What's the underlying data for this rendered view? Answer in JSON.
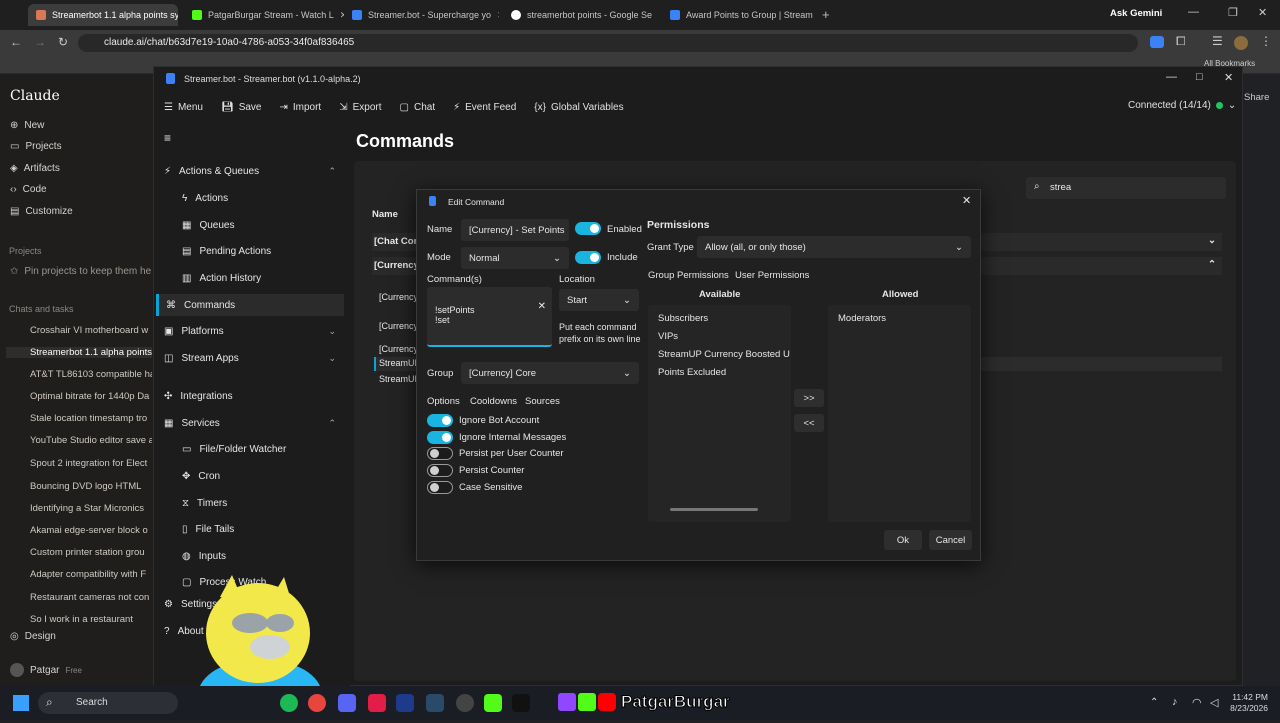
{
  "browser": {
    "tabs": [
      {
        "title": "Streamerbot 1.1 alpha points sy",
        "color": "#d97757"
      },
      {
        "title": "PatgarBurgar Stream - Watch L",
        "color": "#53fc18"
      },
      {
        "title": "Streamer.bot - Supercharge yo",
        "color": "#3b82f6"
      },
      {
        "title": "streamerbot points - Google Se",
        "color": "#ffffff"
      },
      {
        "title": "Award Points to Group | Stream",
        "color": "#3b82f6"
      }
    ],
    "ask_gemini": "Ask Gemini",
    "url": "claude.ai/chat/b63d7e19-10a0-4786-a053-34f0af836465",
    "all_bookmarks": "All Bookmarks"
  },
  "claude": {
    "brand": "Claude",
    "new": "New",
    "projects": "Projects",
    "artifacts": "Artifacts",
    "code": "Code",
    "customize": "Customize",
    "projects_head": "Projects",
    "pin": "Pin projects to keep them he",
    "chats_head": "Chats and tasks",
    "chats": [
      "Crosshair VI motherboard w",
      "Streamerbot 1.1 alpha points",
      "AT&T TL86103 compatible ha",
      "Optimal bitrate for 1440p Da",
      "Stale location timestamp tro",
      "YouTube Studio editor save a",
      "Spout 2 integration for Elect",
      "Bouncing DVD logo HTML",
      "Identifying a Star Micronics",
      "Akamai edge-server block o",
      "Custom printer station grou",
      "Adapter compatibility with F",
      "Restaurant cameras not con",
      "So I work in a restaurant"
    ],
    "design": "Design",
    "user": "Patgar",
    "plan": "Free",
    "share": "Share"
  },
  "sb": {
    "title": "Streamer.bot - Streamer.bot (v1.1.0-alpha.2)",
    "toolbar": {
      "menu": "Menu",
      "save": "Save",
      "import": "Import",
      "export": "Export",
      "chat": "Chat",
      "event_feed": "Event Feed",
      "global_vars": "Global Variables"
    },
    "connected": "Connected (14/14)",
    "nav": {
      "actions_queues": "Actions & Queues",
      "actions": "Actions",
      "queues": "Queues",
      "pending": "Pending Actions",
      "history": "Action History",
      "commands": "Commands",
      "platforms": "Platforms",
      "stream_apps": "Stream Apps",
      "integrations": "Integrations",
      "services": "Services",
      "file_watcher": "File/Folder Watcher",
      "cron": "Cron",
      "timers": "Timers",
      "file_tails": "File Tails",
      "inputs": "Inputs",
      "process": "Process Watch",
      "settings": "Settings",
      "about": "About"
    },
    "page_title": "Commands",
    "search_value": "strea",
    "col_name": "Name",
    "rows": [
      "[Chat Com",
      "[Currency",
      "[Currency",
      "[Currency",
      "[Currency",
      "StreamUP",
      "StreamUP"
    ]
  },
  "dialog": {
    "title": "Edit Command",
    "name_label": "Name",
    "name_value": "[Currency] - Set Points",
    "enabled": "Enabled",
    "mode_label": "Mode",
    "mode_value": "Normal",
    "include": "Include",
    "commands_label": "Command(s)",
    "command_line1": "!setPoints",
    "command_line2": "!set",
    "location_label": "Location",
    "location_value": "Start",
    "location_hint": "Put each command prefix on its own line",
    "group_label": "Group",
    "group_value": "[Currency] Core",
    "tabs": [
      "Options",
      "Cooldowns",
      "Sources"
    ],
    "options": [
      {
        "label": "Ignore Bot Account",
        "on": true
      },
      {
        "label": "Ignore Internal Messages",
        "on": true
      },
      {
        "label": "Persist per User Counter",
        "on": false
      },
      {
        "label": "Persist Counter",
        "on": false
      },
      {
        "label": "Case Sensitive",
        "on": false
      }
    ],
    "permissions": "Permissions",
    "grant_label": "Grant Type",
    "grant_value": "Allow (all, or only those)",
    "perm_tabs": [
      "Group Permissions",
      "User Permissions"
    ],
    "available_head": "Available",
    "allowed_head": "Allowed",
    "available": [
      "Subscribers",
      "VIPs",
      "StreamUP Currency Boosted U",
      "Points Excluded"
    ],
    "allowed": [
      "Moderators"
    ],
    "move_right": ">>",
    "move_left": "<<",
    "ok": "Ok",
    "cancel": "Cancel"
  },
  "taskbar": {
    "search": "Search",
    "time": "11:42 PM",
    "date": "8/23/2026",
    "overlay": "PatgarBurgar"
  }
}
